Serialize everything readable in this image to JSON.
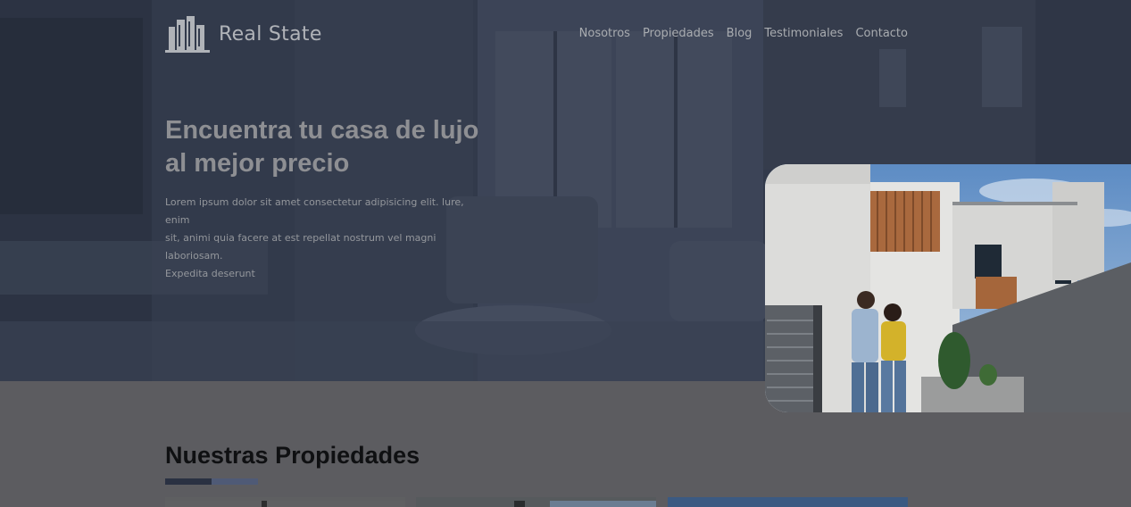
{
  "brand": {
    "name": "Real State",
    "logo_icon": "buildings-icon"
  },
  "nav": {
    "items": [
      {
        "label": "Nosotros"
      },
      {
        "label": "Propiedades"
      },
      {
        "label": "Blog"
      },
      {
        "label": "Testimoniales"
      },
      {
        "label": "Contacto"
      }
    ]
  },
  "hero": {
    "headline_line1": "Encuentra tu casa de lujo",
    "headline_line2": "al mejor precio",
    "description_line1": "Lorem ipsum dolor sit amet consectetur adipisicing elit. lure, enim",
    "description_line2": "sit, animi quia facere at est repellat nostrum vel magni laboriosam.",
    "description_line3": "Expedita deserunt"
  },
  "properties": {
    "title_regular": "Nuestras",
    "title_bold": "Propiedades"
  },
  "colors": {
    "hero_overlay": "#343c4d",
    "accent_dark": "#2a3142",
    "accent_light": "#4f5a76",
    "section_bg": "#5c5c60"
  }
}
